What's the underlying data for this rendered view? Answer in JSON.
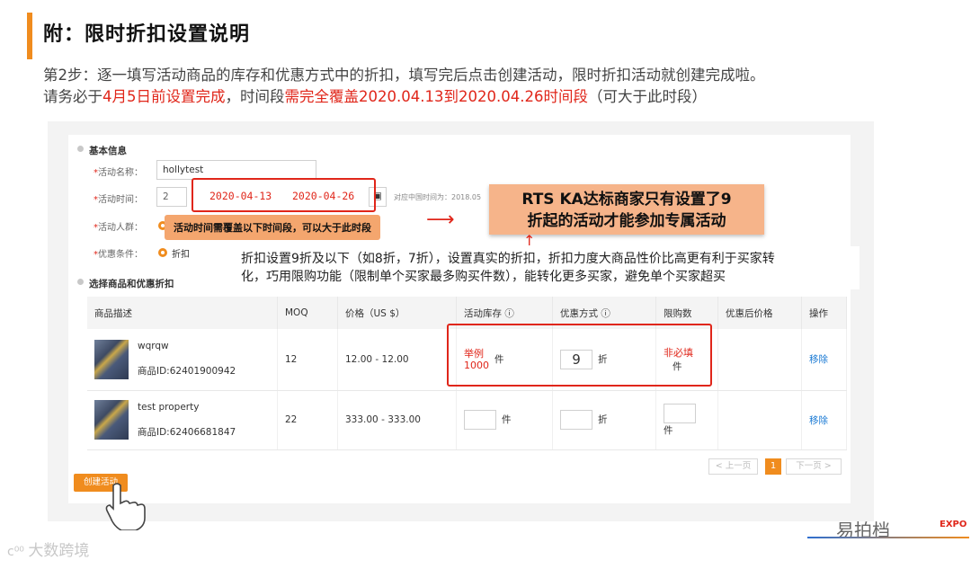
{
  "header": {
    "title": "附：限时折扣设置说明",
    "desc_line1": "第2步：逐一填写活动商品的库存和优惠方式中的折扣，填写完后点击创建活动，限时折扣活动就创建完成啦。",
    "desc_line2_a": "请务必于",
    "desc_line2_b": "4月5日前设置完成",
    "desc_line2_c": "，时间段",
    "desc_line2_d": "需完全覆盖2020.04.13到2020.04.26时间段",
    "desc_line2_e": "（可大于此时段）"
  },
  "form": {
    "section_basic": "基本信息",
    "label_name": "活动名称：",
    "value_name": "hollytest",
    "label_time": "活动时间：",
    "time_start": "2020-04-13",
    "time_end": "2020-04-26",
    "time_prefix": "2",
    "timezone_note": "对应中国时间为：2018.05",
    "label_audience": "活动人群：",
    "label_condition": "优惠条件：",
    "condition_value": "折扣",
    "section_products": "选择商品和优惠折扣"
  },
  "callouts": {
    "time_note": "活动时间需覆盖以下时间段，可以大于此时段",
    "arrow": "⟶",
    "rts_line1": "RTS KA达标商家只有设置了9",
    "rts_line2": "折起的活动才能参加专属活动",
    "discount_note_line1": "折扣设置9折及以下（如8折，7折），设置真实的折扣，折扣力度大商品性价比高更有利于买家转",
    "discount_note_line2": "化，巧用限购功能（限制单个买家最多购买件数），能转化更多买家，避免单个买家超买",
    "example_label": "举例",
    "example_value": "1000",
    "optional_label": "非必填"
  },
  "table": {
    "headers": [
      "商品描述",
      "MOQ",
      "价格（US $）",
      "活动库存 ⓘ",
      "优惠方式 ⓘ",
      "限购数",
      "优惠后价格",
      "操作"
    ],
    "rows": [
      {
        "name": "wqrqw",
        "id": "商品ID:62401900942",
        "moq": "12",
        "price": "12.00 - 12.00",
        "stock_unit": "件",
        "discount": "9",
        "discount_unit": "折",
        "limit_unit": "件",
        "action": "移除"
      },
      {
        "name": "test property",
        "id": "商品ID:62406681847",
        "moq": "22",
        "price": "333.00 - 333.00",
        "stock_unit": "件",
        "discount": "",
        "discount_unit": "折",
        "limit_unit": "件",
        "action": "移除"
      }
    ]
  },
  "pager": {
    "prev": "< 上一页",
    "current": "1",
    "next": "下一页 >"
  },
  "create_button": "创建活动",
  "watermarks": {
    "left": "大数跨境",
    "right": "易拍档",
    "expo": "EXPO"
  }
}
